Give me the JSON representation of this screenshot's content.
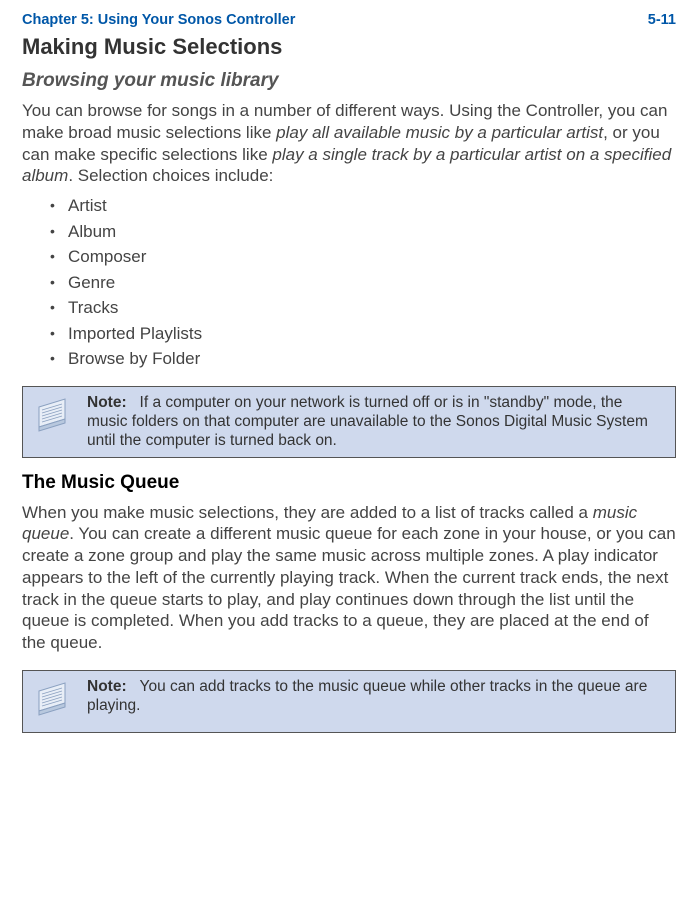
{
  "header": {
    "chapter": "Chapter 5:  Using Your Sonos Controller",
    "pageNumber": "5-11"
  },
  "section1": {
    "heading": "Making Music Selections",
    "subheading": "Browsing your music library",
    "para_pre": "You can browse for songs in a number of different ways. Using the Controller, you can make broad music selections like ",
    "para_italic1": "play all available music by a particular artist",
    "para_mid": ", or you can make specific selections like ",
    "para_italic2": "play a single track by a particular artist on a specified album",
    "para_post": ". Selection choices include:",
    "list": [
      "Artist",
      "Album",
      "Composer",
      "Genre",
      "Tracks",
      "Imported Playlists",
      "Browse by Folder"
    ]
  },
  "note1": {
    "label": "Note:",
    "text": "If a computer on your network is turned off or is in \"standby\" mode, the music folders on that computer are unavailable to the Sonos Digital Music System until the computer is turned back on."
  },
  "section2": {
    "heading": "The Music Queue",
    "para_pre": "When you make music selections, they are added to a list of tracks called a ",
    "para_italic": "music queue",
    "para_post": ". You can create a different music queue for each zone in your house, or you can create a zone group and play the same music across multiple zones. A play indicator appears to the left of the currently playing track. When the current track ends, the next track in the queue starts to play, and play continues down through the list until the queue is completed. When you add tracks to a queue, they are placed at the end of the queue."
  },
  "note2": {
    "label": "Note:",
    "text": "You can add tracks to the music queue while other tracks in the queue are playing."
  }
}
